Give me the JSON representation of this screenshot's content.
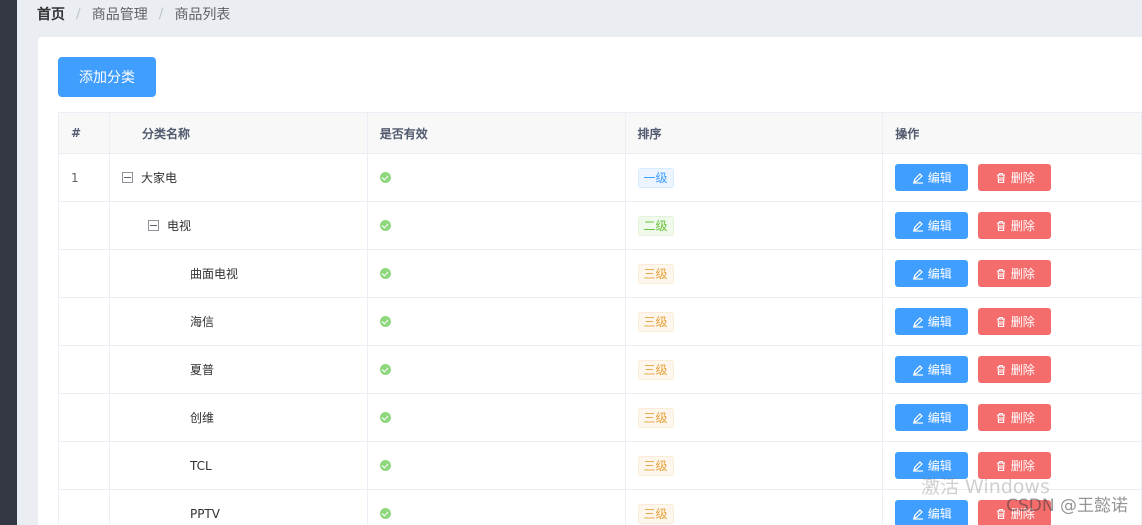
{
  "breadcrumb": {
    "home": "首页",
    "section": "商品管理",
    "page": "商品列表",
    "separator": "/"
  },
  "toolbar": {
    "add_label": "添加分类"
  },
  "table": {
    "headers": [
      "#",
      "分类名称",
      "是否有效",
      "排序",
      "操作"
    ],
    "rows": [
      {
        "index": "1",
        "name": "大家电",
        "level": "一级",
        "level_class": "l1",
        "depth": 0,
        "expandable": true
      },
      {
        "index": "",
        "name": "电视",
        "level": "二级",
        "level_class": "l2",
        "depth": 1,
        "expandable": true
      },
      {
        "index": "",
        "name": "曲面电视",
        "level": "三级",
        "level_class": "l3",
        "depth": 2,
        "expandable": false
      },
      {
        "index": "",
        "name": "海信",
        "level": "三级",
        "level_class": "l3",
        "depth": 2,
        "expandable": false
      },
      {
        "index": "",
        "name": "夏普",
        "level": "三级",
        "level_class": "l3",
        "depth": 2,
        "expandable": false
      },
      {
        "index": "",
        "name": "创维",
        "level": "三级",
        "level_class": "l3",
        "depth": 2,
        "expandable": false
      },
      {
        "index": "",
        "name": "TCL",
        "level": "三级",
        "level_class": "l3",
        "depth": 2,
        "expandable": false
      },
      {
        "index": "",
        "name": "PPTV",
        "level": "三级",
        "level_class": "l3",
        "depth": 2,
        "expandable": false
      }
    ],
    "edit_label": "编辑",
    "delete_label": "删除"
  },
  "overlay": {
    "activate_text": "激活 Windows",
    "watermark": "CSDN @王懿诺"
  },
  "colors": {
    "primary": "#409eff",
    "danger": "#f56c6c",
    "success": "#67c23a",
    "warning": "#e6a23c",
    "sidebar": "#333744"
  }
}
